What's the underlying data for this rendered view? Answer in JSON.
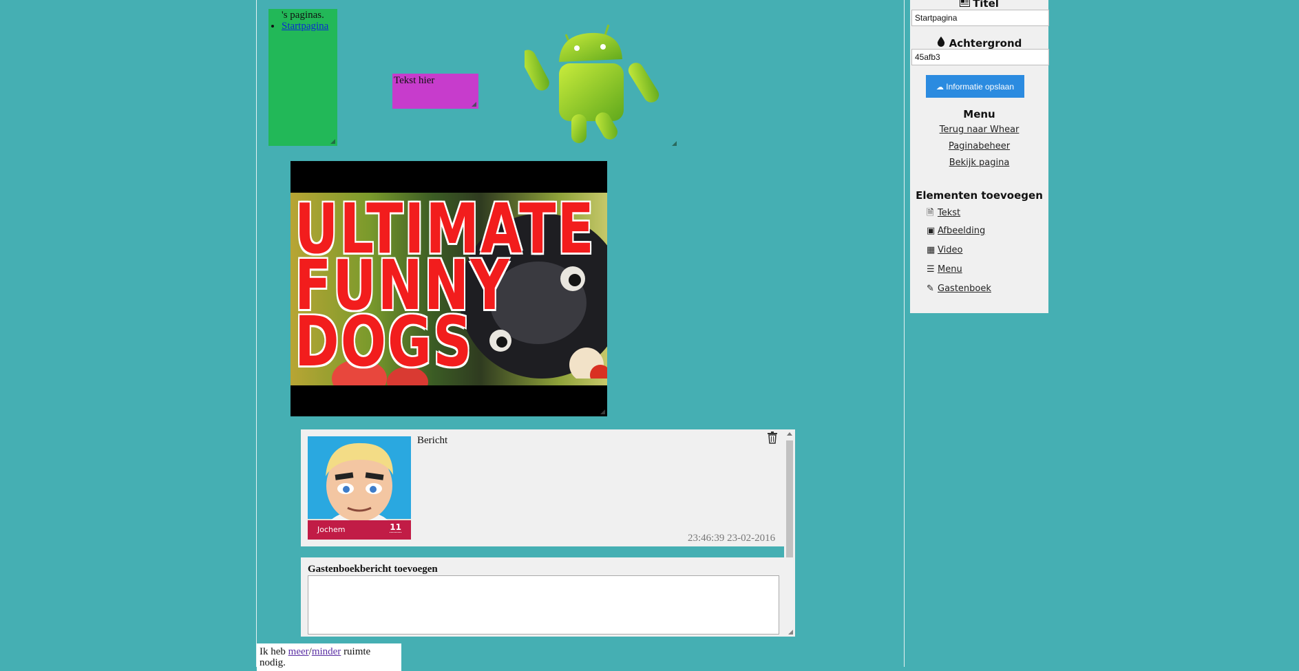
{
  "menu_element": {
    "intro": "'s paginas.",
    "items": [
      "Startpagina"
    ]
  },
  "text_element": {
    "text": "Tekst hier"
  },
  "video": {
    "lines": [
      "ULTIMATE",
      "FUNNY",
      "DOGS"
    ]
  },
  "guestbook": {
    "entries": [
      {
        "author": "Jochem",
        "count": "11",
        "message": "Bericht",
        "timestamp": "23:46:39 23-02-2016"
      }
    ],
    "add_title": "Gastenboekbericht toevoegen"
  },
  "space_note": {
    "prefix": "Ik heb ",
    "more": "meer",
    "sep": "/",
    "less": "minder",
    "suffix": " ruimte nodig."
  },
  "sidebar": {
    "title_label": "Titel",
    "title_value": "Startpagina",
    "background_label": "Achtergrond",
    "background_value": "45afb3",
    "save_button": "Informatie opslaan",
    "menu_heading": "Menu",
    "menu_links": [
      "Terug naar Whear",
      "Paginabeheer",
      "Bekijk pagina"
    ],
    "add_heading": "Elementen toevoegen",
    "add_items": [
      {
        "label": "Tekst",
        "icon": "word-doc-icon"
      },
      {
        "label": "Afbeelding",
        "icon": "image-icon"
      },
      {
        "label": "Video",
        "icon": "film-icon"
      },
      {
        "label": "Menu",
        "icon": "list-icon"
      },
      {
        "label": "Gastenboek",
        "icon": "comments-icon"
      }
    ]
  },
  "colors": {
    "page_bg": "#45afb3",
    "menu_bg": "#22b858",
    "text_bg": "#c73ccc",
    "accent": "#2b8be0",
    "avatar_bar": "#c11c46"
  }
}
